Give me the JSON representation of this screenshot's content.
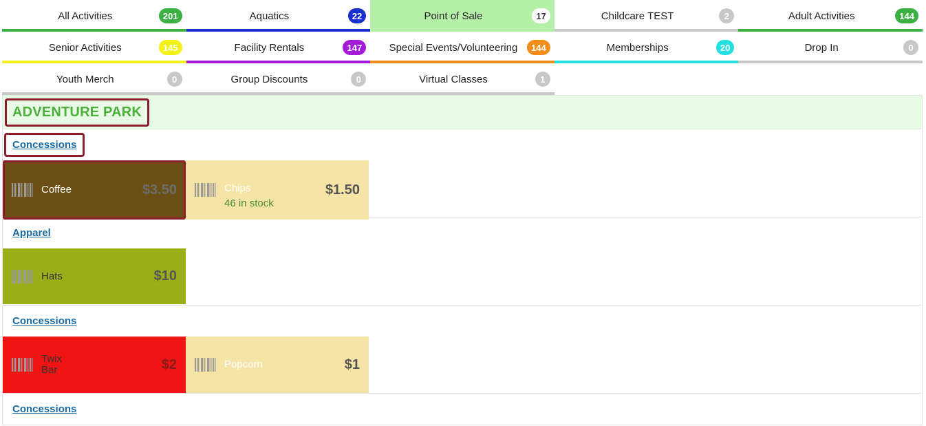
{
  "tabs": [
    {
      "label": "All Activities",
      "count": "201",
      "badge_color": "#3cb043",
      "bar_color": "#3cb043",
      "bg": "#ffffff"
    },
    {
      "label": "Aquatics",
      "count": "22",
      "badge_color": "#1a2fcf",
      "bar_color": "#1a2fcf",
      "bg": "#ffffff"
    },
    {
      "label": "Point of Sale",
      "count": "17",
      "badge_color": "#ffffff",
      "badge_text": "#333333",
      "bar_color": "#b5f0a8",
      "bg": "#b5f0a8"
    },
    {
      "label": "Childcare TEST",
      "count": "2",
      "badge_color": "#c8c8c8",
      "bar_color": "#c8c8c8",
      "bg": "#ffffff"
    },
    {
      "label": "Adult Activities",
      "count": "144",
      "badge_color": "#3cb043",
      "bar_color": "#3cb043",
      "bg": "#ffffff"
    },
    {
      "label": "Senior Activities",
      "count": "145",
      "badge_color": "#f2f21a",
      "bar_color": "#f2f21a",
      "bg": "#ffffff"
    },
    {
      "label": "Facility Rentals",
      "count": "147",
      "badge_color": "#a51ad8",
      "bar_color": "#a51ad8",
      "bg": "#ffffff"
    },
    {
      "label": "Special Events/Volunteering",
      "count": "144",
      "badge_color": "#f28c1a",
      "bar_color": "#f28c1a",
      "bg": "#ffffff"
    },
    {
      "label": "Memberships",
      "count": "20",
      "badge_color": "#22e0e0",
      "bar_color": "#22e0e0",
      "bg": "#ffffff"
    },
    {
      "label": "Drop In",
      "count": "0",
      "badge_color": "#c8c8c8",
      "bar_color": "#c8c8c8",
      "bg": "#ffffff"
    },
    {
      "label": "Youth Merch",
      "count": "0",
      "badge_color": "#c8c8c8",
      "bar_color": "#c8c8c8",
      "bg": "#ffffff"
    },
    {
      "label": "Group Discounts",
      "count": "0",
      "badge_color": "#c8c8c8",
      "bar_color": "#c8c8c8",
      "bg": "#ffffff"
    },
    {
      "label": "Virtual Classes",
      "count": "1",
      "badge_color": "#c8c8c8",
      "bar_color": "#c8c8c8",
      "bg": "#ffffff"
    }
  ],
  "park": {
    "title": "ADVENTURE PARK"
  },
  "sections": [
    {
      "label": "Concessions",
      "products": [
        {
          "name": "Coffee",
          "price": "$3.50",
          "stock": "",
          "bg": "#6b4f14",
          "name_color": "#ffffff",
          "price_color": "#6e6e6e"
        },
        {
          "name": "Chips",
          "price": "$1.50",
          "stock": "46 in stock",
          "bg": "#f5e4a6",
          "name_color": "#ffffff",
          "price_color": "#555555"
        }
      ]
    },
    {
      "label": "Apparel",
      "products": [
        {
          "name": "Hats",
          "price": "$10",
          "stock": "",
          "bg": "#9aae1a",
          "name_color": "#333333",
          "price_color": "#555555"
        }
      ]
    },
    {
      "label": "Concessions",
      "products": [
        {
          "name": "Twix\nBar",
          "price": "$2",
          "stock": "",
          "bg": "#f01414",
          "name_color": "#333333",
          "price_color": "#8a1a1a"
        },
        {
          "name": "Popcorn",
          "price": "$1",
          "stock": "",
          "bg": "#f5e4a6",
          "name_color": "#ffffff",
          "price_color": "#555555"
        }
      ]
    },
    {
      "label": "Concessions",
      "products": []
    }
  ]
}
